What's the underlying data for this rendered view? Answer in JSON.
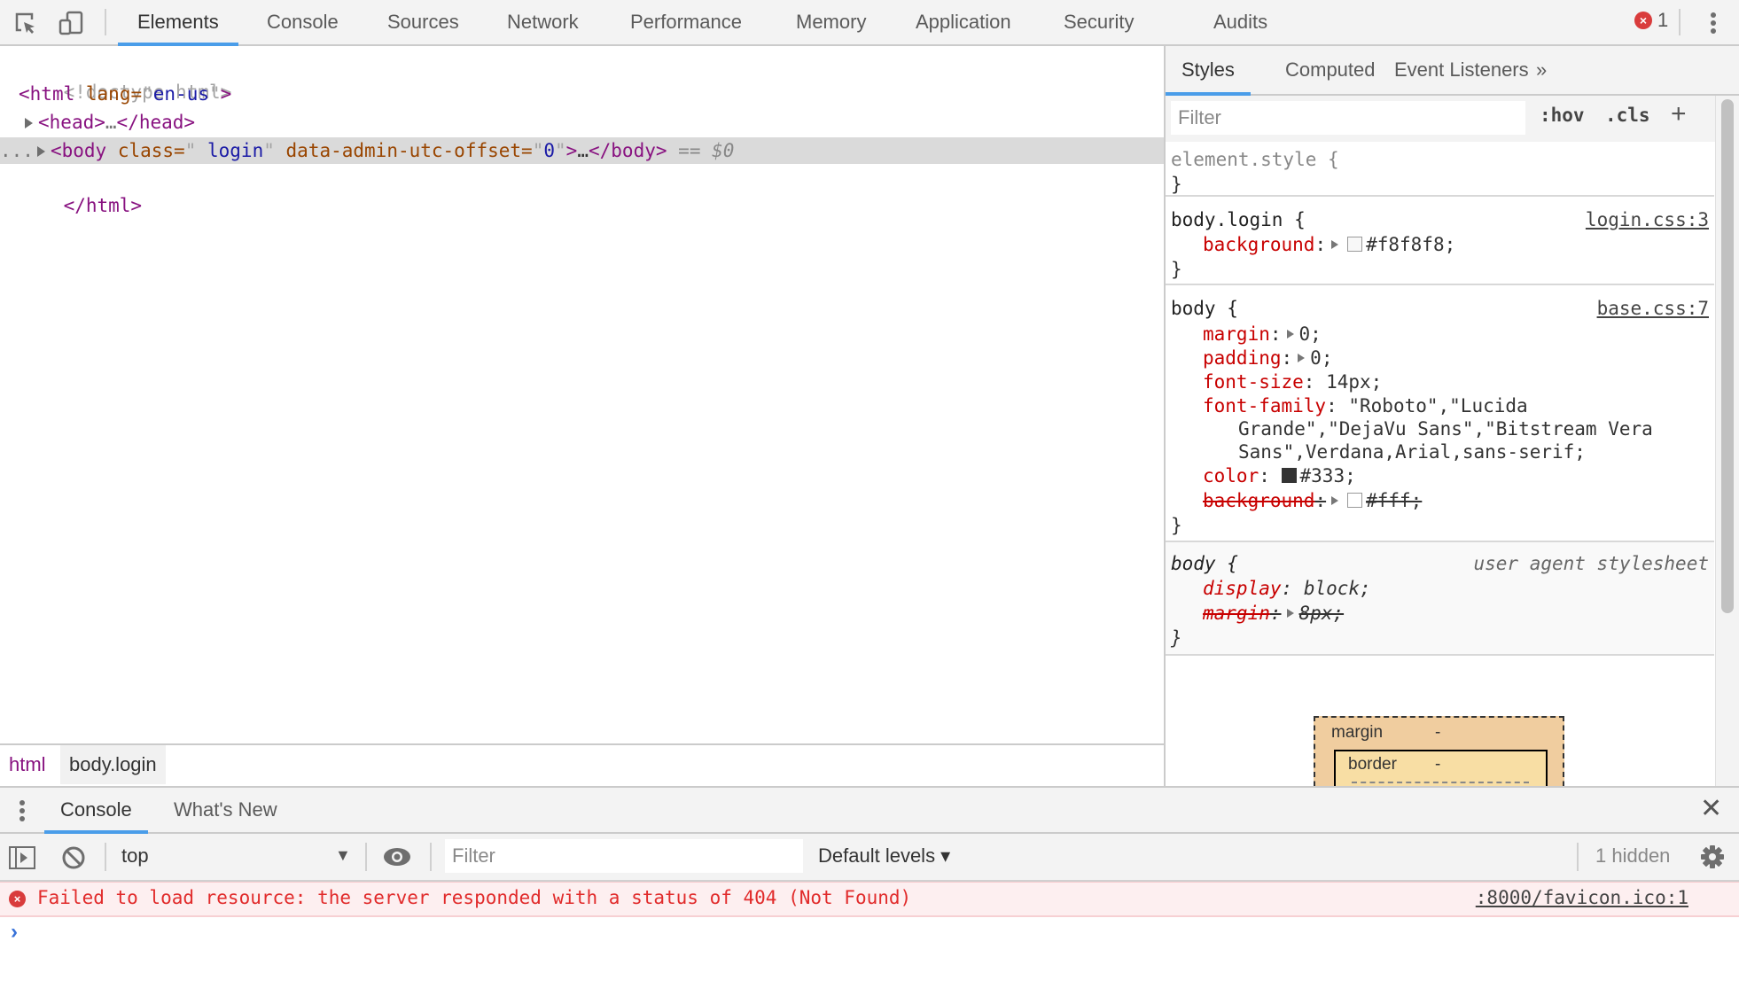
{
  "toolbar": {
    "icons": [
      "inspect-element-icon",
      "device-toolbar-icon"
    ],
    "tabs": [
      {
        "label": "Elements",
        "active": true
      },
      {
        "label": "Console"
      },
      {
        "label": "Sources"
      },
      {
        "label": "Network"
      },
      {
        "label": "Performance"
      },
      {
        "label": "Memory"
      },
      {
        "label": "Application"
      },
      {
        "label": "Security"
      },
      {
        "label": "Audits"
      }
    ],
    "error_badge_icon": "×",
    "error_count": "1"
  },
  "dom": {
    "doctype": "<!doctype html>",
    "html_open": {
      "tag": "html",
      "attr": "lang",
      "value": "en-us"
    },
    "head": {
      "tag": "head",
      "ellipsis": "…"
    },
    "body": {
      "tag": "body",
      "attr1": "class",
      "value1": " login",
      "attr2": "data-admin-utc-offset",
      "value2": "0",
      "ellipsis": "…",
      "marker": "== $0",
      "dots": "..."
    },
    "html_close": "</html>"
  },
  "breadcrumb": [
    "html",
    "body.login"
  ],
  "styles": {
    "tabs": [
      {
        "label": "Styles",
        "active": true
      },
      {
        "label": "Computed"
      },
      {
        "label": "Event Listeners"
      },
      {
        "label": "»"
      }
    ],
    "filter_placeholder": "Filter",
    "hov": ":hov",
    "cls": ".cls",
    "add": "+",
    "rules": {
      "element_style": {
        "selector": "element.style {",
        "close": "}"
      },
      "body_login": {
        "selector": "body.login {",
        "source": "login.css:3",
        "decl": {
          "name": "background",
          "value": "#f8f8f8;",
          "swatch": "#f8f8f8"
        },
        "close": "}"
      },
      "body_base": {
        "selector": "body {",
        "source": "base.css:7",
        "margin": {
          "name": "margin",
          "value": "0;"
        },
        "padding": {
          "name": "padding",
          "value": "0;"
        },
        "font_size": {
          "name": "font-size",
          "value": "14px;"
        },
        "font_family": {
          "name": "font-family",
          "value1": "\"Roboto\",\"Lucida",
          "value2": "Grande\",\"DejaVu Sans\",\"Bitstream Vera",
          "value3": "Sans\",Verdana,Arial,sans-serif;"
        },
        "color": {
          "name": "color",
          "value": "#333;",
          "swatch": "#333333"
        },
        "background": {
          "name": "background",
          "value": "#fff;",
          "swatch": "#ffffff",
          "overridden": true
        },
        "close": "}"
      },
      "body_ua": {
        "selector": "body {",
        "source": "user agent stylesheet",
        "display": {
          "name": "display",
          "value": "block;"
        },
        "margin": {
          "name": "margin",
          "value": "8px;",
          "overridden": true
        },
        "close": "}"
      }
    },
    "box_model": {
      "margin_label": "margin",
      "margin_value": "-",
      "border_label": "border",
      "border_value": "-"
    }
  },
  "drawer": {
    "tabs": [
      {
        "label": "Console",
        "active": true
      },
      {
        "label": "What's New"
      }
    ],
    "close": "✕"
  },
  "console": {
    "context": "top",
    "context_arrow": "▼",
    "filter_placeholder": "Filter",
    "levels": "Default levels ▾",
    "hidden": "1 hidden",
    "messages": [
      {
        "level": "error",
        "icon": "×",
        "text": "Failed to load resource: the server responded with a status of 404 (Not Found)",
        "source": ":8000/favicon.ico:1"
      }
    ],
    "prompt": "›"
  },
  "colors": {
    "accent": "#4a9de9",
    "error": "#d93c3c",
    "error_text": "#e12b2b",
    "error_bg": "#fdeff0"
  }
}
